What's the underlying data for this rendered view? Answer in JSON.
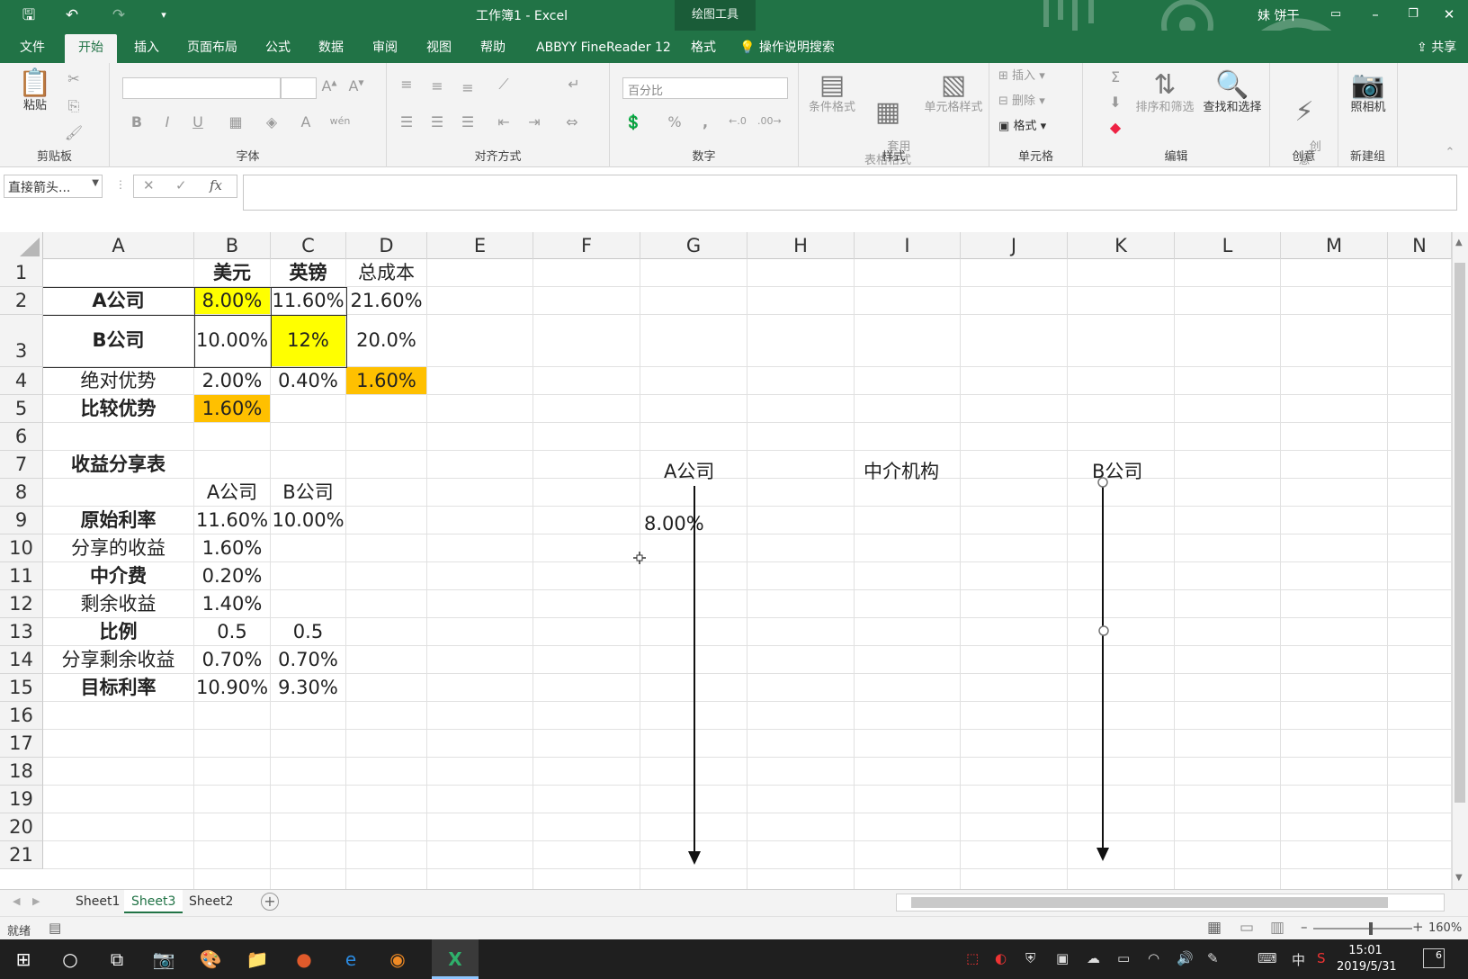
{
  "window": {
    "title": "工作簿1 - Excel",
    "context_tab": "绘图工具",
    "user": "妹 饼干"
  },
  "menu_tabs": [
    "文件",
    "开始",
    "插入",
    "页面布局",
    "公式",
    "数据",
    "审阅",
    "视图",
    "帮助",
    "ABBYY FineReader 12",
    "格式"
  ],
  "active_tab": "开始",
  "tell_me": "操作说明搜索",
  "share": "共享",
  "ribbon": {
    "clipboard": {
      "label": "剪贴板",
      "paste": "粘贴"
    },
    "font": {
      "label": "字体",
      "bold": "B",
      "italic": "I",
      "underline": "U",
      "font_color": "A",
      "phonetic": "wén"
    },
    "alignment": {
      "label": "对齐方式"
    },
    "number": {
      "label": "数字",
      "format_value": "百分比",
      "percent": "%",
      "comma": ","
    },
    "styles": {
      "label": "样式",
      "conditional": "条件格式",
      "table_format": "套用\n表格格式",
      "cell_styles": "单元格样式"
    },
    "cells": {
      "label": "单元格",
      "insert": "插入",
      "delete": "删除",
      "format": "格式"
    },
    "editing": {
      "label": "编辑",
      "sort": "排序和筛选",
      "find": "查找和选择"
    },
    "creative": {
      "label": "创意",
      "btn": "创\n意"
    },
    "new_group": {
      "label": "新建组",
      "camera": "照相机"
    }
  },
  "formula_bar": {
    "name_box": "直接箭头...",
    "fx": "fx",
    "formula": ""
  },
  "columns": [
    "A",
    "B",
    "C",
    "D",
    "E",
    "F",
    "G",
    "H",
    "I",
    "J",
    "K",
    "L",
    "M",
    "N"
  ],
  "rows": [
    "1",
    "2",
    "3",
    "4",
    "5",
    "6",
    "7",
    "8",
    "9",
    "10",
    "11",
    "12",
    "13",
    "14",
    "15",
    "16",
    "17",
    "18",
    "19",
    "20",
    "21"
  ],
  "cells": {
    "B1": "美元",
    "C1": "英镑",
    "D1": "总成本",
    "A2": "A公司",
    "B2": "8.00%",
    "C2": "11.60%",
    "D2": "21.60%",
    "A3": "B公司",
    "B3": "10.00%",
    "C3": "12%",
    "D3": "20.0%",
    "A4": "绝对优势",
    "B4": "2.00%",
    "C4": "0.40%",
    "D4": "1.60%",
    "A5": "比较优势",
    "B5": "1.60%",
    "A7": "收益分享表",
    "B8": "A公司",
    "C8": "B公司",
    "A9": "原始利率",
    "B9": "11.60%",
    "C9": "10.00%",
    "A10": "分享的收益",
    "B10": "1.60%",
    "A11": "中介费",
    "B11": "0.20%",
    "A12": "剩余收益",
    "B12": "1.40%",
    "A13": "比例",
    "B13": "0.5",
    "C13": "0.5",
    "A14": "分享剩余收益",
    "B14": "0.70%",
    "C14": "0.70%",
    "A15": "目标利率",
    "B15": "10.90%",
    "C15": "9.30%",
    "G7": "A公司",
    "I7": "中介机构",
    "K7": "B公司",
    "G9": "8.00%"
  },
  "highlight_colors": {
    "yellow": "#ffff00",
    "orange": "#ffc000"
  },
  "sheet_tabs": [
    "Sheet1",
    "Sheet3",
    "Sheet2"
  ],
  "active_sheet": "Sheet3",
  "status": {
    "ready": "就绪",
    "zoom": "160%"
  },
  "clock": {
    "time": "15:01",
    "date": "2019/5/31"
  },
  "tray": {
    "ime": "中",
    "notifications": "6"
  }
}
